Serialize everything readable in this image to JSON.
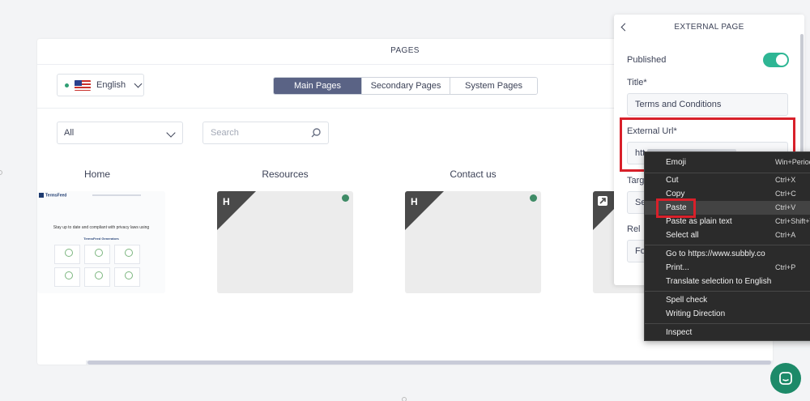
{
  "pages_panel": {
    "header_title": "PAGES",
    "language": "English",
    "tabs": [
      {
        "label": "Main Pages",
        "active": true
      },
      {
        "label": "Secondary Pages",
        "active": false
      },
      {
        "label": "System Pages",
        "active": false
      }
    ],
    "filter_value": "All",
    "search_placeholder": "Search",
    "cards": [
      {
        "title": "Home",
        "type": "preview"
      },
      {
        "title": "Resources",
        "type": "template",
        "badge": "H"
      },
      {
        "title": "Contact us",
        "type": "template",
        "badge": "H"
      }
    ],
    "home_preview": {
      "logo": "TermsFeed",
      "heading": "Stay up to date and compliant with privacy laws using",
      "subheading": "TermsFeed Generators"
    }
  },
  "external_panel": {
    "title": "EXTERNAL PAGE",
    "published_label": "Published",
    "published": true,
    "title_label": "Title*",
    "title_value": "Terms and Conditions",
    "url_label": "External Url*",
    "url_value_visible": "htt",
    "target_label_partial": "Targ",
    "target_value_partial": "Sel",
    "rel_label": "Rel",
    "rel_value_partial": "Fol"
  },
  "context_menu": {
    "items": [
      {
        "label": "Emoji",
        "shortcut": "Win+Period"
      },
      {
        "separator": true
      },
      {
        "label": "Cut",
        "shortcut": "Ctrl+X"
      },
      {
        "label": "Copy",
        "shortcut": "Ctrl+C"
      },
      {
        "label": "Paste",
        "shortcut": "Ctrl+V",
        "highlighted": true
      },
      {
        "label": "Paste as plain text",
        "shortcut": "Ctrl+Shift+V"
      },
      {
        "label": "Select all",
        "shortcut": "Ctrl+A"
      },
      {
        "separator": true
      },
      {
        "label": "Go to https://www.subbly.co",
        "shortcut": ""
      },
      {
        "label": "Print...",
        "shortcut": "Ctrl+P"
      },
      {
        "label": "Translate selection to English",
        "shortcut": ""
      },
      {
        "separator": true
      },
      {
        "label": "Spell check",
        "shortcut": ""
      },
      {
        "label": "Writing Direction",
        "shortcut": ""
      },
      {
        "separator": true
      },
      {
        "label": "Inspect",
        "shortcut": ""
      }
    ]
  },
  "colors": {
    "accent_green": "#2eb694",
    "tab_active": "#5a6385",
    "highlight_red": "#d8202a",
    "menu_bg": "#2b2b2b"
  }
}
